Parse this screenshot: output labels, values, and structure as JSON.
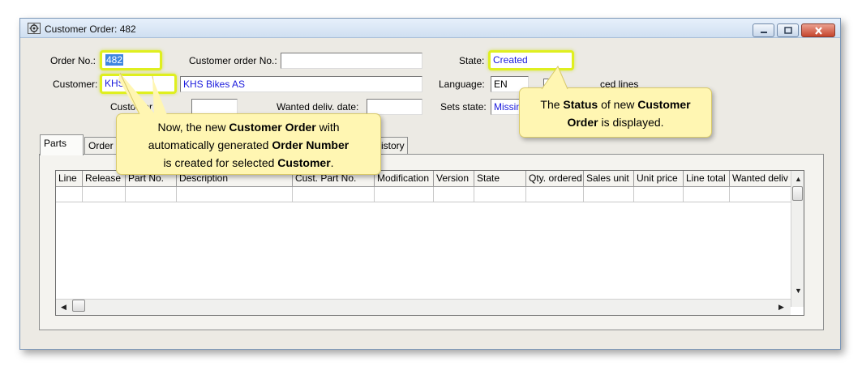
{
  "window": {
    "title": "Customer Order: 482"
  },
  "header": {
    "order_no_label": "Order No.:",
    "order_no_value": "482",
    "customer_order_no_label": "Customer order No.:",
    "customer_order_no_value": "",
    "state_label": "State:",
    "state_value": "Created",
    "customer_label": "Customer:",
    "customer_code": "KHS",
    "customer_name": "KHS Bikes AS",
    "language_label": "Language:",
    "language_value": "EN",
    "closed_lines_label": "ced lines",
    "customer_date_label": "Customer d",
    "customer_date_value": "",
    "wanted_deliv_label": "Wanted deliv. date:",
    "wanted_deliv_value": "",
    "sets_state_label": "Sets state:",
    "sets_state_value": "Missin"
  },
  "tabs": [
    {
      "label": "Parts"
    },
    {
      "label": "Order i"
    },
    {
      "label": "istory"
    }
  ],
  "table": {
    "columns": [
      "Line",
      "Release",
      "Part No.",
      "Description",
      "Cust. Part No.",
      "Modification",
      "Version",
      "State",
      "Qty. ordered",
      "Sales unit",
      "Unit price",
      "Line total",
      "Wanted deliv"
    ]
  },
  "callouts": {
    "order": {
      "line1": "Now, the new ",
      "line1_bold": "Customer Order",
      "line1_end": " with",
      "line2": "automatically generated ",
      "line2_bold": "Order Number",
      "line3": "is created for selected ",
      "line3_bold": "Customer",
      "line3_end": "."
    },
    "status": {
      "p1": "The ",
      "p1_bold": "Status",
      "p2": " of new ",
      "p2_bold": "Customer",
      "p3_bold": "Order",
      "p3": " is displayed."
    }
  },
  "colors": {
    "highlight": "#dfef1f",
    "callout_bg": "#fff6b2",
    "value_text": "#1a1adc"
  },
  "icons": [
    "app-icon",
    "minimize-icon",
    "maximize-icon",
    "close-icon",
    "scroll-up-icon",
    "scroll-down-icon",
    "scroll-left-icon",
    "scroll-right-icon"
  ]
}
